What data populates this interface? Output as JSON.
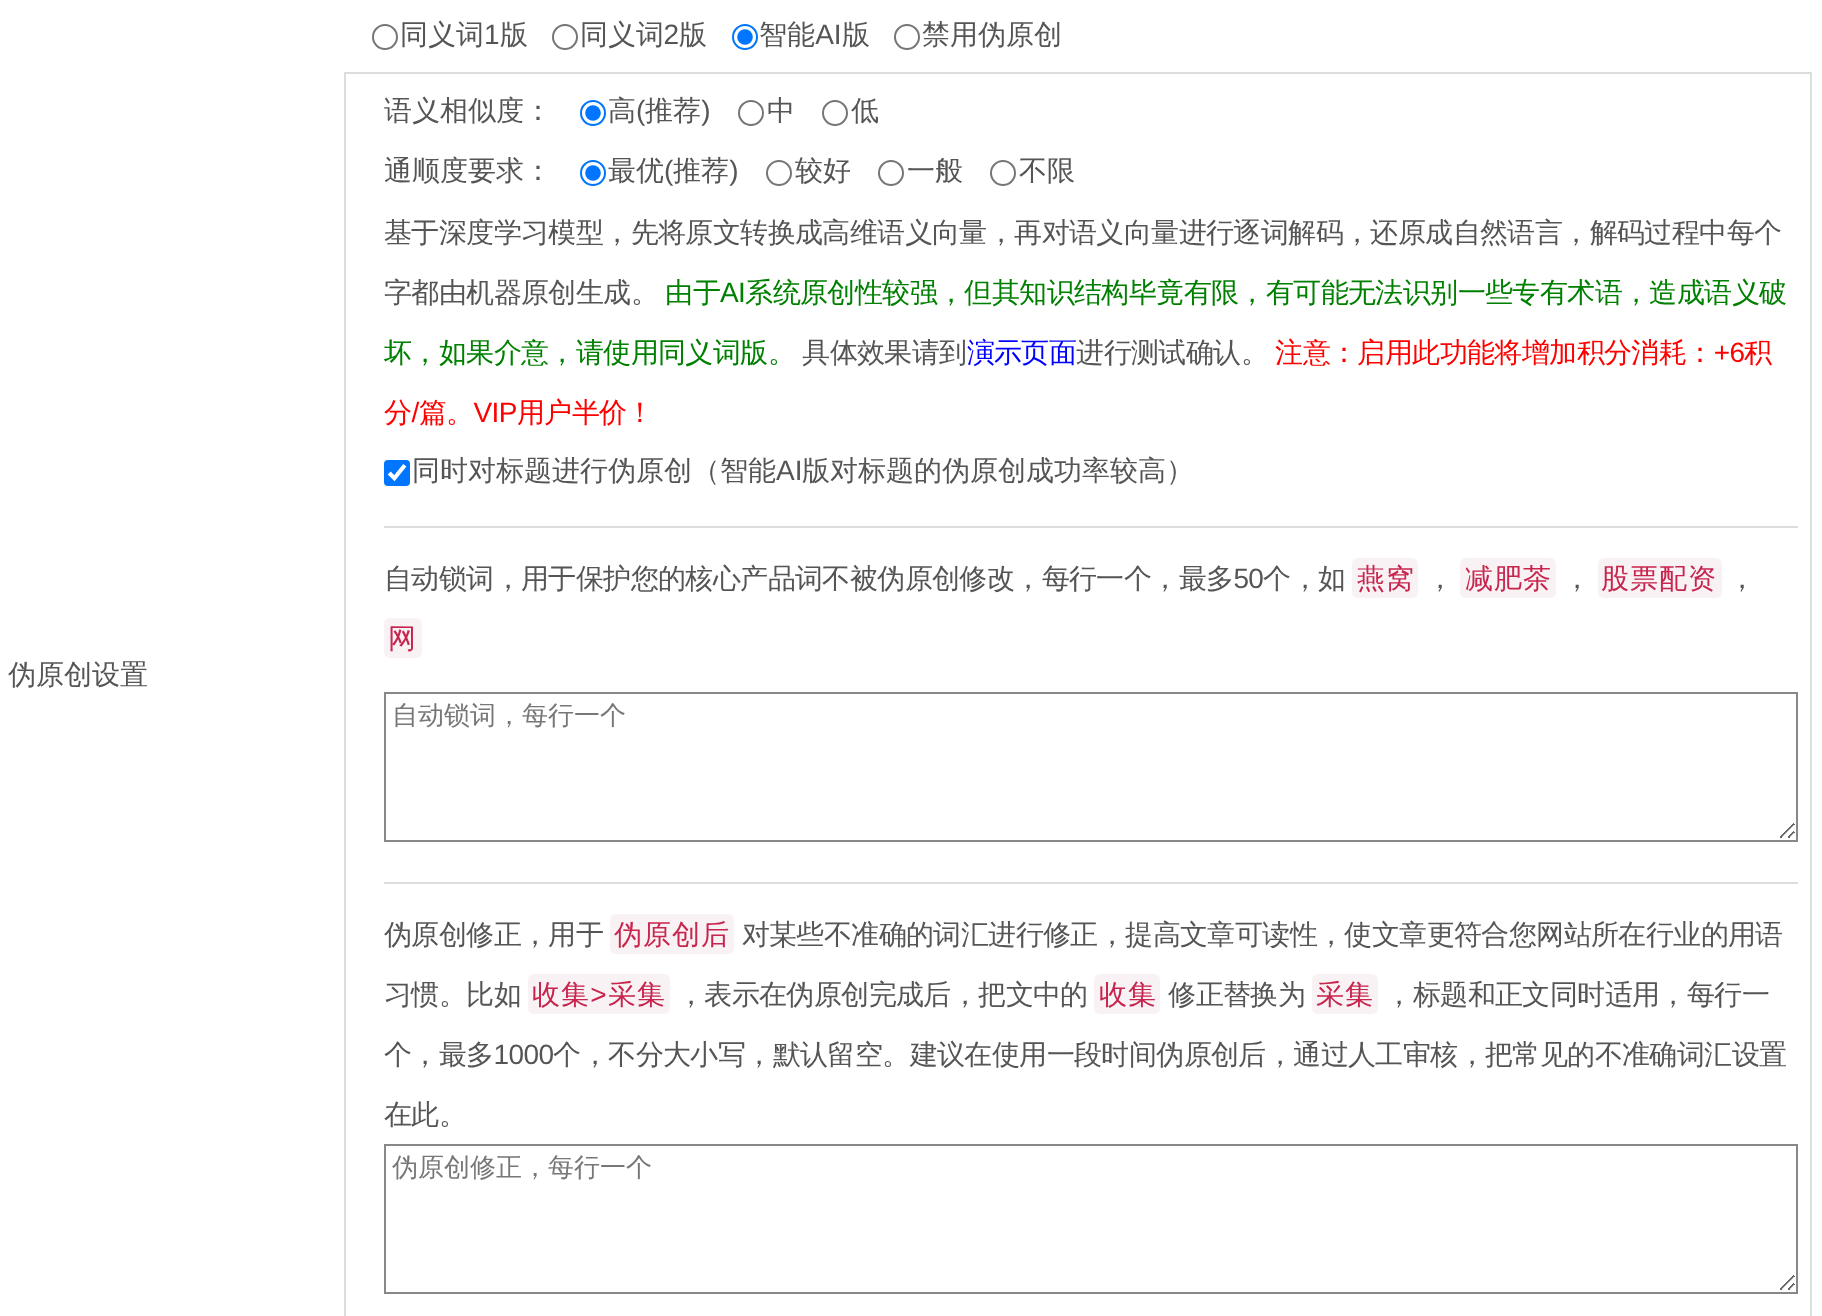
{
  "section_label": "伪原创设置",
  "modes": [
    {
      "label": "同义词1版",
      "selected": false
    },
    {
      "label": "同义词2版",
      "selected": false
    },
    {
      "label": "智能AI版",
      "selected": true
    },
    {
      "label": "禁用伪原创",
      "selected": false
    }
  ],
  "ai_options": {
    "settings": [
      {
        "label": "语义相似度：",
        "options": [
          {
            "label": "高(推荐)",
            "selected": true
          },
          {
            "label": "中",
            "selected": false
          },
          {
            "label": "低",
            "selected": false
          }
        ]
      },
      {
        "label": "通顺度要求：",
        "options": [
          {
            "label": "最优(推荐)",
            "selected": true
          },
          {
            "label": "较好",
            "selected": false
          },
          {
            "label": "一般",
            "selected": false
          },
          {
            "label": "不限",
            "selected": false
          }
        ]
      }
    ],
    "description": [
      {
        "kind": "plain",
        "text": "基于深度学习模型，先将原文转换成高维语义向量，再对语义向量进行逐词解码，还原成自然语言，解码过程中每个字都由机器原创生成。 "
      },
      {
        "kind": "notice",
        "text": "由于AI系统原创性较强，但其知识结构毕竟有限，有可能无法识别一些专有术语，造成语义破坏，如果介意，请使用同义词版。"
      },
      {
        "kind": "plain",
        "text": " 具体效果请到"
      },
      {
        "kind": "link",
        "text": "演示页面"
      },
      {
        "kind": "plain",
        "text": "进行测试确认。 "
      },
      {
        "kind": "warning",
        "text": "注意：启用此功能将增加积分消耗：+6积分/篇。VIP用户半价！"
      }
    ],
    "title_checkbox": {
      "label": "同时对标题进行伪原创（智能AI版对标题的伪原创成功率较高）",
      "checked": true
    }
  },
  "lock_words": {
    "description": [
      {
        "kind": "plain",
        "text": "自动锁词，用于保护您的核心产品词不被伪原创修改，每行一个，最多50个，如 "
      },
      {
        "kind": "code",
        "text": "燕窝"
      },
      {
        "kind": "plain",
        "text": " ， "
      },
      {
        "kind": "code",
        "text": "减肥茶"
      },
      {
        "kind": "plain",
        "text": " ， "
      },
      {
        "kind": "code",
        "text": "股票配资"
      },
      {
        "kind": "plain",
        "text": " ， "
      },
      {
        "kind": "code",
        "text": "网"
      }
    ],
    "placeholder": "自动锁词，每行一个"
  },
  "correction": {
    "description": [
      {
        "kind": "plain",
        "text": "伪原创修正，用于 "
      },
      {
        "kind": "code",
        "text": "伪原创后"
      },
      {
        "kind": "plain",
        "text": " 对某些不准确的词汇进行修正，提高文章可读性，使文章更符合您网站所在行业的用语习惯。比如 "
      },
      {
        "kind": "code",
        "text": "收集>采集"
      },
      {
        "kind": "plain",
        "text": " ，表示在伪原创完成后，把文中的 "
      },
      {
        "kind": "code",
        "text": "收集"
      },
      {
        "kind": "plain",
        "text": " 修正替换为 "
      },
      {
        "kind": "code",
        "text": "采集"
      },
      {
        "kind": "plain",
        "text": " ，标题和正文同时适用，每行一个，最多1000个，不分大小写，默认留空。建议在使用一段时间伪原创后，通过人工审核，把常见的不准确词汇设置在此。"
      }
    ],
    "placeholder": "伪原创修正，每行一个"
  }
}
